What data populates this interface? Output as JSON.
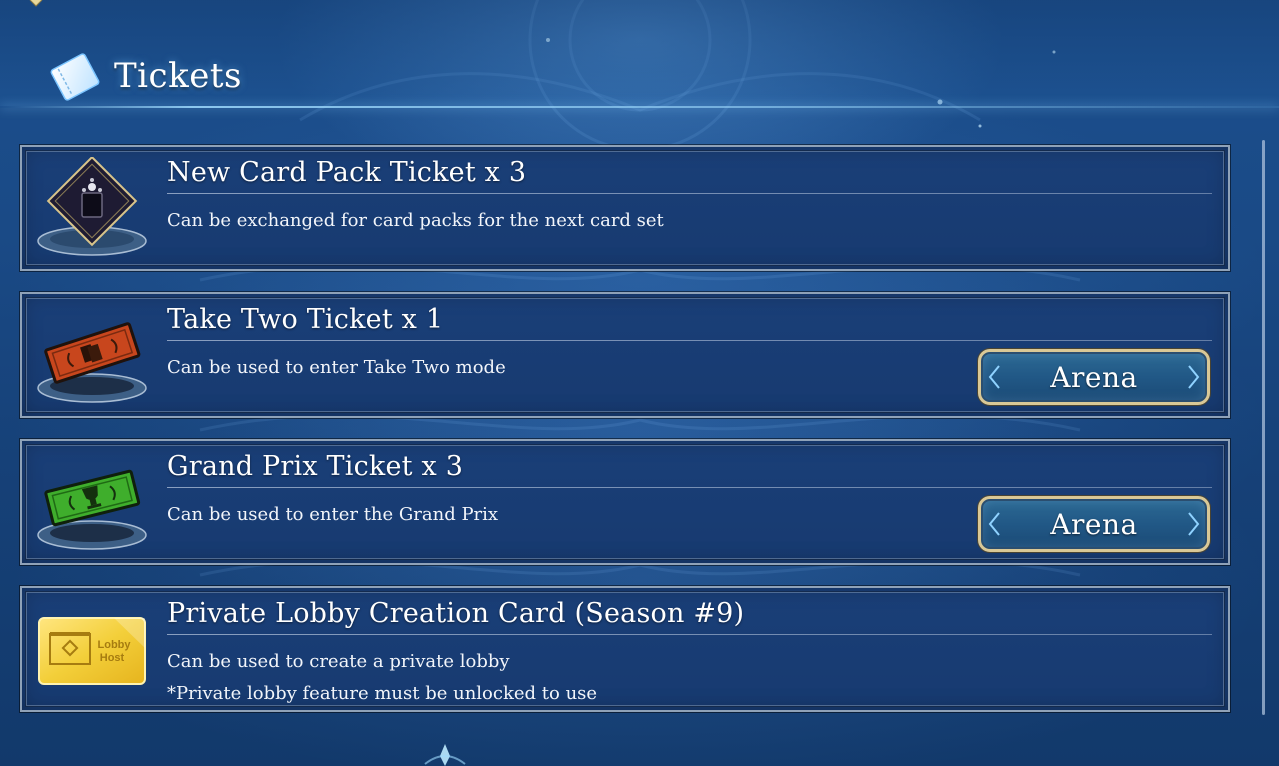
{
  "header": {
    "title": "Tickets",
    "icon": "ticket-icon"
  },
  "tickets": [
    {
      "title": "New Card Pack Ticket x 3",
      "desc_lines": [
        "Can be exchanged for card packs for the next card set"
      ],
      "icon": "card-pack-ticket-icon",
      "button": null
    },
    {
      "title": "Take Two Ticket x 1",
      "desc_lines": [
        "Can be used to enter Take Two mode"
      ],
      "icon": "take-two-ticket-icon",
      "button": "Arena"
    },
    {
      "title": "Grand Prix Ticket x 3",
      "desc_lines": [
        "Can be used to enter the Grand Prix"
      ],
      "icon": "grand-prix-ticket-icon",
      "button": "Arena"
    },
    {
      "title": "Private Lobby Creation Card (Season #9)",
      "desc_lines": [
        "Can be used to create a private lobby",
        "*Private lobby feature must be unlocked to use"
      ],
      "icon": "lobby-host-card-icon",
      "icon_text": [
        "Lobby",
        "Host"
      ],
      "button": null
    }
  ],
  "colors": {
    "background": "#1a4a86",
    "card_fill": "#1a3f78",
    "card_border": "#8fa2b8",
    "button_border": "#d9c896",
    "button_fill": "#215886",
    "take_two_ticket": "#c8461d",
    "grand_prix_ticket": "#3fae2c",
    "lobby_card": "#f3cf3a"
  }
}
